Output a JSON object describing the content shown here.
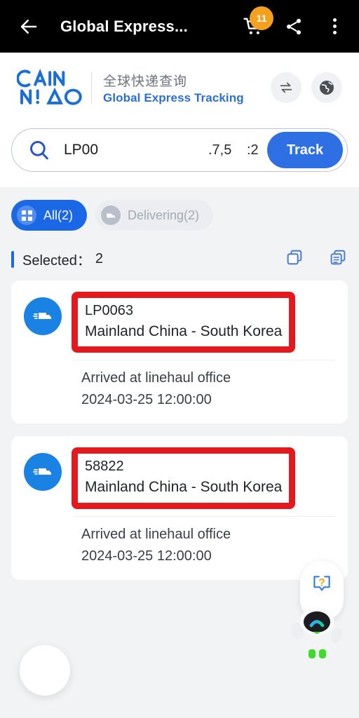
{
  "topbar": {
    "back_icon": "arrow-left-icon",
    "title": "Global Express...",
    "cart_icon": "shopping-cart-icon",
    "cart_badge": "11",
    "share_icon": "share-icon",
    "overflow_icon": "more-vertical-icon",
    "badge_color": "#f5a11e",
    "background": "#000000"
  },
  "brand": {
    "logo_line1": "C",
    "logo_name": "cainiao-logo",
    "title_cn": "全球快递查询",
    "title_en": "Global Express Tracking",
    "title_en_color": "#2b6fd6",
    "swap_icon": "swap-arrows-icon",
    "globe_icon": "globe-icon"
  },
  "search": {
    "search_icon": "search-icon",
    "value": "LP00",
    "fragment_a": ".7,5",
    "fragment_b": ":2",
    "track_label": "Track",
    "track_color": "#2f6fe4"
  },
  "filters": {
    "chips": [
      {
        "label": "All(2)",
        "icon": "grid-icon",
        "active": true
      },
      {
        "label": "Delivering(2)",
        "icon": "truck-icon",
        "active": false
      }
    ],
    "active_color": "#1a68e5"
  },
  "selection": {
    "label": "Selected：",
    "count": "2",
    "copy_icon": "copy-squares-icon",
    "copy_doc_icon": "copy-document-icon",
    "icon_color": "#4e7fd4"
  },
  "shipments": [
    {
      "truck_icon": "truck-icon",
      "tracking_id": "LP0063",
      "route": "Mainland China - South Korea",
      "status": "Arrived at linehaul office",
      "timestamp": "2024-03-25 12:00:00",
      "highlight_color": "#e3191e"
    },
    {
      "truck_icon": "truck-icon",
      "tracking_id": "58822",
      "route": "Mainland China - South Korea",
      "status": "Arrived at linehaul office",
      "timestamp": "2024-03-25 12:00:00",
      "highlight_color": "#e3191e"
    }
  ],
  "assistant": {
    "help_icon": "question-bubble-icon",
    "robot_icon": "robot-mascot-icon"
  },
  "fab": {
    "name": "floating-action-button"
  }
}
